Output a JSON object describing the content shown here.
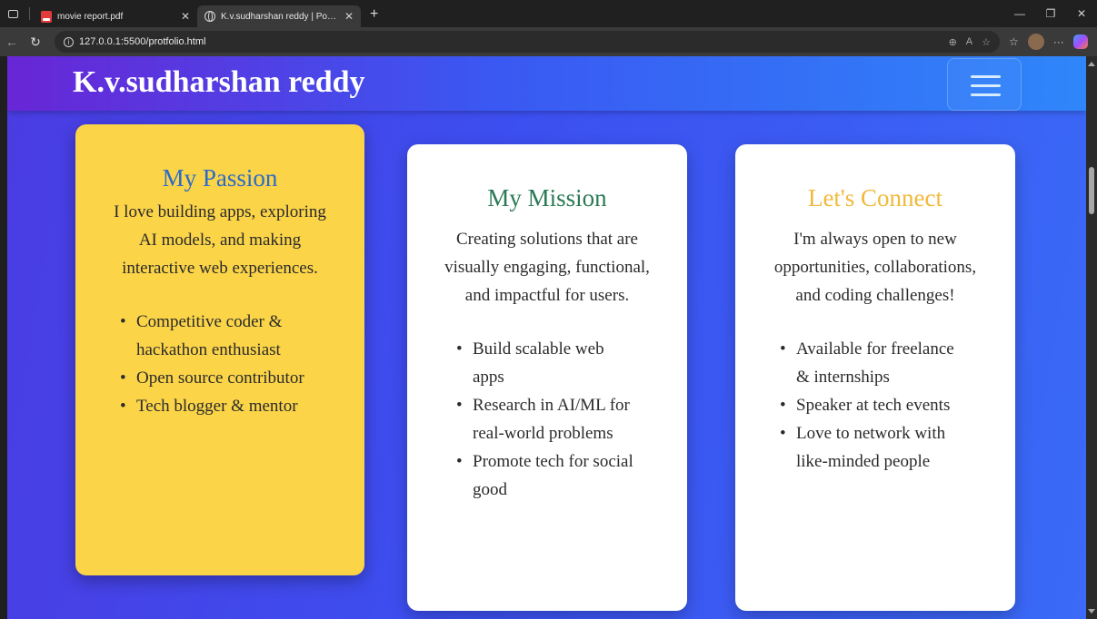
{
  "browser": {
    "tabs": [
      {
        "title": "movie report.pdf",
        "icon": "pdf-icon",
        "active": false
      },
      {
        "title": "K.v.sudharshan reddy | Portfolio",
        "icon": "globe-icon",
        "active": true
      }
    ],
    "url": "127.0.0.1:5500/protfolio.html"
  },
  "site": {
    "title": "K.v.sudharshan reddy"
  },
  "cards": {
    "passion": {
      "heading": "My Passion",
      "text": "I love building apps, exploring AI models, and making interactive web experiences.",
      "items": [
        "Competitive coder & hackathon enthusiast",
        "Open source contributor",
        "Tech blogger & mentor"
      ]
    },
    "mission": {
      "heading": "My Mission",
      "text": "Creating solutions that are visually engaging, functional, and impactful for users.",
      "items": [
        "Build scalable web apps",
        "Research in AI/ML for real-world problems",
        "Promote tech for social good"
      ]
    },
    "connect": {
      "heading": "Let's Connect",
      "text": "I'm always open to new opportunities, collaborations, and coding challenges!",
      "items": [
        "Available for freelance & internships",
        "Speaker at tech events",
        "Love to network with like-minded people"
      ]
    }
  },
  "colors": {
    "passion_card": "#fbd448",
    "passion_heading": "#2b6bc9",
    "mission_heading": "#2b7a55",
    "connect_heading": "#f0b93a"
  }
}
